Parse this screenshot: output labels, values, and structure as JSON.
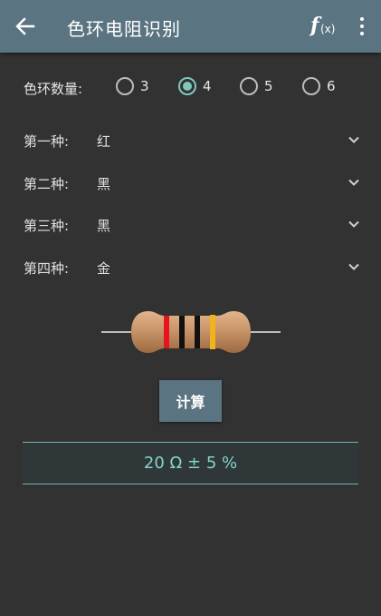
{
  "app": {
    "title": "色环电阻识别"
  },
  "toolbar": {
    "back_icon": "arrow-left-icon",
    "fx_label": "f",
    "fx_sub": "(x)",
    "more_icon": "more-vertical-icon"
  },
  "band_count": {
    "label": "色环数量:",
    "options": [
      "3",
      "4",
      "5",
      "6"
    ],
    "selected": "4"
  },
  "bands": [
    {
      "label": "第一种:",
      "value": "红",
      "color": "#e8141b"
    },
    {
      "label": "第二种:",
      "value": "黑",
      "color": "#111111"
    },
    {
      "label": "第三种:",
      "value": "黑",
      "color": "#111111"
    },
    {
      "label": "第四种:",
      "value": "金",
      "color": "#f2b21a"
    }
  ],
  "calculate_label": "计算",
  "result": "20 Ω ± 5 %",
  "colors": {
    "appbar": "#5b7481",
    "background": "#323232",
    "accent": "#7fc8bd",
    "resistor_body": "#c9956a"
  }
}
